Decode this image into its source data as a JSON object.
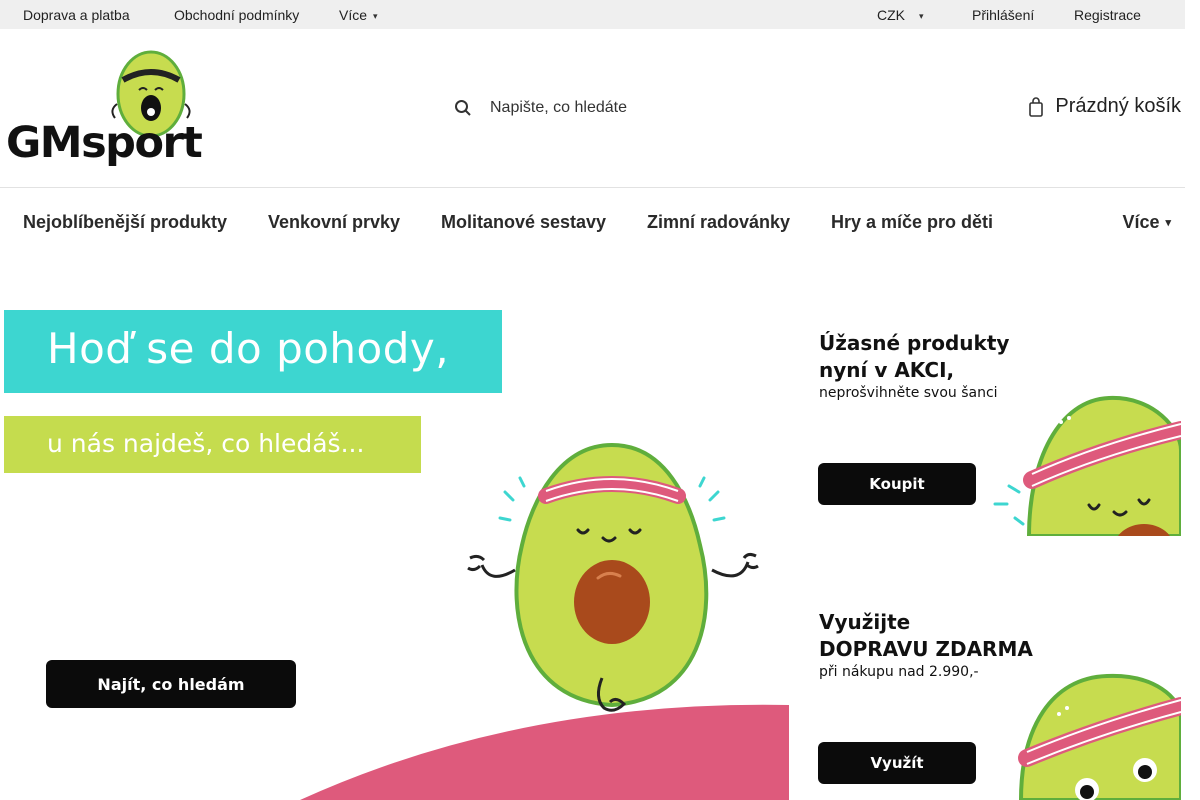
{
  "topbar": {
    "links": [
      {
        "label": "Doprava a platba"
      },
      {
        "label": "Obchodní podmínky"
      },
      {
        "label": "Více"
      }
    ],
    "currency": "CZK",
    "login": "Přihlášení",
    "register": "Registrace"
  },
  "header": {
    "logo_text": "GMsport",
    "search_placeholder": "Napište, co hledáte",
    "cart_label": "Prázdný košík"
  },
  "nav": {
    "items": [
      {
        "label": "Nejoblíbenější produkty"
      },
      {
        "label": "Venkovní prvky"
      },
      {
        "label": "Molitanové sestavy"
      },
      {
        "label": "Zimní radovánky"
      },
      {
        "label": "Hry a míče pro děti"
      }
    ],
    "more": "Více"
  },
  "hero": {
    "line1": "Hoď se do pohody,",
    "line2": "u nás najdeš, co hledáš...",
    "button": "Najít, co hledám"
  },
  "promos": [
    {
      "title_line1": "Úžasné produkty",
      "title_line2": "nyní v AKCI,",
      "subtitle": "neprošvihněte svou šanci",
      "button": "Koupit"
    },
    {
      "title_line1": "Využijte",
      "title_line2": "DOPRAVU ZDARMA",
      "subtitle": "při nákupu nad 2.990,-",
      "button": "Využít"
    }
  ],
  "colors": {
    "teal": "#3dd6d0",
    "lime": "#c5dc4e",
    "pink": "#de5a7c",
    "avocado": "#c7dc4f",
    "avocado_dark": "#5fae3c",
    "pit": "#a94a1c"
  }
}
